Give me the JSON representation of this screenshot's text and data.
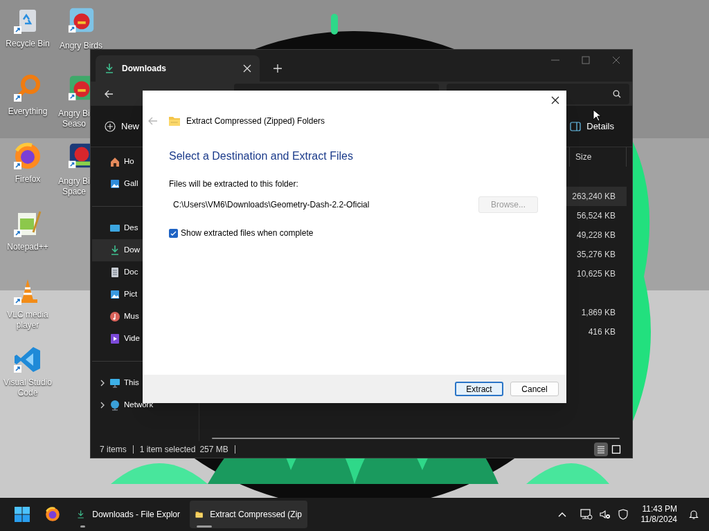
{
  "desktop_icons": {
    "column_1": [
      {
        "label": "Recycle Bin",
        "kind": "recycle"
      },
      {
        "label": "Everything",
        "kind": "magnifier"
      },
      {
        "label": "Firefox",
        "kind": "browser"
      },
      {
        "label": "Notepad++",
        "kind": "notepad"
      },
      {
        "label": "VLC media player",
        "kind": "cone"
      },
      {
        "label": "Visual Studio Code",
        "kind": "code"
      }
    ],
    "column_2": [
      {
        "label": "Angry Birds",
        "kind": "game"
      },
      {
        "label": "Angry Bi Seaso",
        "kind": "game_green"
      },
      {
        "label": "Angry Bi Space",
        "kind": "game_space"
      }
    ]
  },
  "explorer": {
    "tab": {
      "title": "Downloads"
    },
    "command_bar": {
      "new_label": "New",
      "details_label": "Details"
    },
    "nav_items": [
      {
        "label": "Ho",
        "kind": "home",
        "selected": false
      },
      {
        "label": "Gall",
        "kind": "gallery",
        "selected": false
      },
      {
        "kind": "separator"
      },
      {
        "label": "Des",
        "kind": "desktop",
        "selected": false
      },
      {
        "label": "Dow",
        "kind": "download",
        "selected": true
      },
      {
        "label": "Doc",
        "kind": "document",
        "selected": false
      },
      {
        "label": "Pict",
        "kind": "pictures",
        "selected": false
      },
      {
        "label": "Mus",
        "kind": "music",
        "selected": false
      },
      {
        "label": "Vide",
        "kind": "videos",
        "selected": false
      },
      {
        "kind": "separator"
      },
      {
        "label": "This",
        "kind": "pc",
        "selected": false,
        "expanded": false
      },
      {
        "label": "Network",
        "kind": "network",
        "selected": false,
        "expanded": false
      }
    ],
    "column_header": "Size",
    "rows": [
      {
        "size": "263,240 KB",
        "selected": true
      },
      {
        "size": "56,524 KB",
        "selected": false
      },
      {
        "size": "49,228 KB",
        "selected": false
      },
      {
        "size": "35,276 KB",
        "selected": false
      },
      {
        "size": "10,625 KB",
        "selected": false
      },
      {
        "selected": false
      },
      {
        "size": "1,869 KB",
        "selected": false
      },
      {
        "size": "416 KB",
        "selected": false
      }
    ],
    "status_bar": {
      "item_count": "7 items",
      "selection": "1 item selected",
      "selection_size": "257 MB"
    },
    "view_buttons": [
      {
        "kind": "details",
        "selected": true
      },
      {
        "kind": "tiles",
        "selected": false
      }
    ]
  },
  "dialog": {
    "title": "Extract Compressed (Zipped) Folders",
    "heading": "Select a Destination and Extract Files",
    "folder_label": "Files will be extracted to this folder:",
    "folder_path": "C:\\Users\\VM6\\Downloads\\Geometry-Dash-2.2-Oficial",
    "browse_button": {
      "label": "Browse...",
      "disabled": true
    },
    "show_files_checkbox": {
      "label": "Show extracted files when complete",
      "checked": true
    },
    "buttons": [
      {
        "label": "Extract",
        "default": true
      },
      {
        "label": "Cancel",
        "default": false
      }
    ]
  },
  "taskbar": {
    "items": [
      {
        "kind": "start"
      },
      {
        "kind": "browser"
      },
      {
        "kind": "explorer",
        "label": "Downloads - File Explor",
        "active": false
      },
      {
        "kind": "zip",
        "label": "Extract Compressed (Zip",
        "active": true
      }
    ],
    "clock": {
      "time": "11:43 PM",
      "date": "11/8/2024"
    }
  }
}
